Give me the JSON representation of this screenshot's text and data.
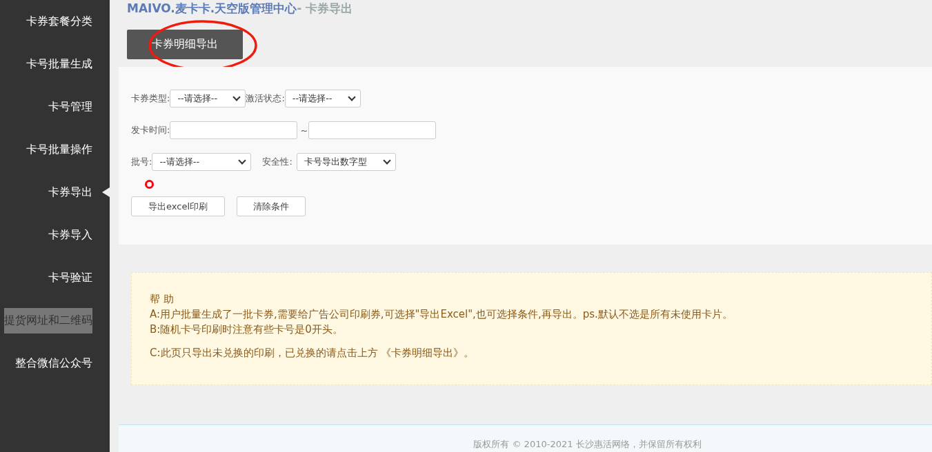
{
  "sidebar": {
    "items": [
      {
        "label": "卡券套餐分类",
        "selected": false,
        "hovered": false
      },
      {
        "label": "卡号批量生成",
        "selected": false,
        "hovered": false
      },
      {
        "label": "卡号管理",
        "selected": false,
        "hovered": false
      },
      {
        "label": "卡号批量操作",
        "selected": false,
        "hovered": false
      },
      {
        "label": "卡券导出",
        "selected": true,
        "hovered": false
      },
      {
        "label": "卡券导入",
        "selected": false,
        "hovered": false
      },
      {
        "label": "卡号验证",
        "selected": false,
        "hovered": false
      },
      {
        "label": "提货网址和二维码",
        "selected": false,
        "hovered": true
      },
      {
        "label": "整合微信公众号",
        "selected": false,
        "hovered": false
      }
    ]
  },
  "header": {
    "title": "MAIVO.麦卡卡.天空版管理中心",
    "separator": "- ",
    "page": "卡券导出"
  },
  "top_button": {
    "label": "卡券明细导出"
  },
  "filters": {
    "card_type": {
      "label": "卡券类型:",
      "value": "--请选择--"
    },
    "activation": {
      "label": "激活状态:",
      "value": "--请选择--"
    },
    "issue_time": {
      "label": "发卡时间:",
      "separator": "~"
    },
    "batch": {
      "label": "批号:",
      "value": "--请选择--"
    },
    "security": {
      "label": "安全性:",
      "value": "卡号导出数字型"
    }
  },
  "buttons": [
    "导出excel印刷",
    "清除条件"
  ],
  "help": {
    "title": "帮 助",
    "lines": [
      "A:用户批量生成了一批卡券,需要给广告公司印刷券,可选择\"导出Excel\",也可选择条件,再导出。ps.默认不选是所有未使用卡片。",
      "B:随机卡号印刷时注意有些卡号是0开头。",
      "C:此页只导出未兑换的印刷，已兑换的请点击上方 《卡券明细导出》。"
    ]
  },
  "footer": {
    "text": "版权所有 © 2010-2021 长沙惠活网络，并保留所有权利"
  }
}
